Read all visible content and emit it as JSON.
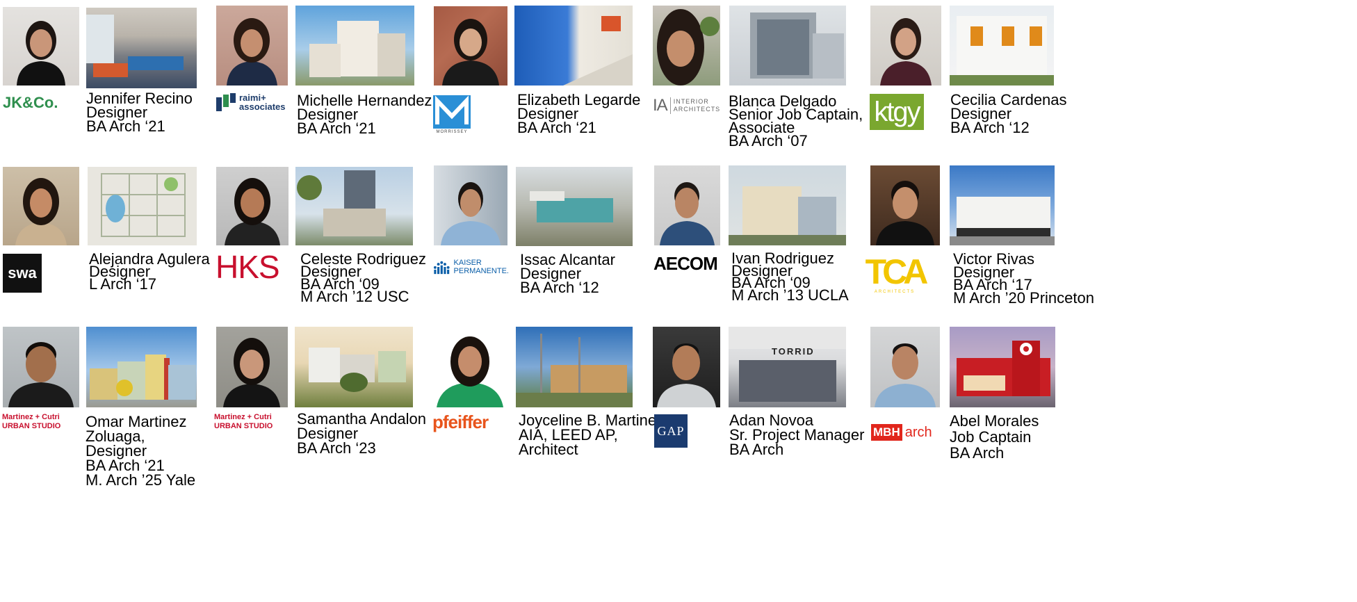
{
  "colors": {
    "jk_green": "#2f8f4e",
    "hks_red": "#c8102e",
    "mc_red": "#c8102e",
    "pfeiffer_orange": "#e8541c",
    "gap_navy": "#1b3b6f",
    "ktgy_green": "#7aa72f",
    "tca_yellow": "#f2c500",
    "mbh_red": "#e1261c",
    "kaiser_blue": "#0a5ea8",
    "raimi_navy": "#1e3d6b"
  },
  "logos": {
    "jk": "JK&Co.",
    "raimi_line1": "raimi+",
    "raimi_line2": "associates",
    "morrissey": "MORRISSEY",
    "ia_mark": "IA",
    "ia_line1": "INTERIOR",
    "ia_line2": "ARCHITECTS",
    "ktgy": "ktgy",
    "swa": "swa",
    "hks": "HKS",
    "kaiser_line1": "KAISER",
    "kaiser_line2": "PERMANENTE.",
    "aecom": "AECOM",
    "tca": "TCA",
    "tca_sub": "ARCHITECTS",
    "mc1_line1": "Martinez + Cutri",
    "mc1_line2": "URBAN STUDIO",
    "mc2_line1": "Martinez + Cutri",
    "mc2_line2": "URBAN STUDIO",
    "pfeiffer": "pfeiffer",
    "gap": "GAP",
    "mbh_box": "MBH",
    "mbh_text": "arch",
    "torrid": "TORRID"
  },
  "people": [
    {
      "lines": [
        "Jennifer Recino",
        "Designer",
        "BA Arch ‘21"
      ]
    },
    {
      "lines": [
        "Michelle Hernandez",
        "Designer",
        "BA Arch ‘21"
      ]
    },
    {
      "lines": [
        "Elizabeth Legarde",
        "Designer",
        "BA Arch ‘21"
      ]
    },
    {
      "lines": [
        "Blanca Delgado",
        "Senior Job Captain,",
        "Associate",
        "BA Arch ‘07"
      ]
    },
    {
      "lines": [
        "Cecilia Cardenas",
        "Designer",
        "BA Arch ‘12"
      ]
    },
    {
      "lines": [
        "Alejandra Agulera",
        "Designer",
        "L Arch ‘17"
      ]
    },
    {
      "lines": [
        "Celeste Rodriguez",
        "Designer",
        "BA Arch ‘09",
        "M Arch ’12 USC"
      ]
    },
    {
      "lines": [
        "Issac Alcantar",
        "Designer",
        "BA Arch ‘12"
      ]
    },
    {
      "lines": [
        "Ivan Rodriguez",
        "Designer",
        "BA Arch ‘09",
        "M Arch ’13 UCLA"
      ]
    },
    {
      "lines": [
        "Victor Rivas",
        "Designer",
        "BA Arch ‘17",
        "M Arch ’20 Princeton"
      ]
    },
    {
      "lines": [
        "Omar Martinez",
        "Zoluaga,",
        "Designer",
        "BA Arch ‘21",
        "M. Arch  ’25 Yale"
      ]
    },
    {
      "lines": [
        "Samantha Andalon",
        "Designer",
        "BA Arch ‘23"
      ]
    },
    {
      "lines": [
        "Joyceline B. Martinez,",
        "AIA, LEED AP,",
        "Architect"
      ]
    },
    {
      "lines": [
        "Adan Novoa",
        "Sr. Project Manager",
        "BA Arch"
      ]
    },
    {
      "lines": [
        "Abel Morales",
        "Job Captain",
        "BA Arch"
      ]
    }
  ]
}
